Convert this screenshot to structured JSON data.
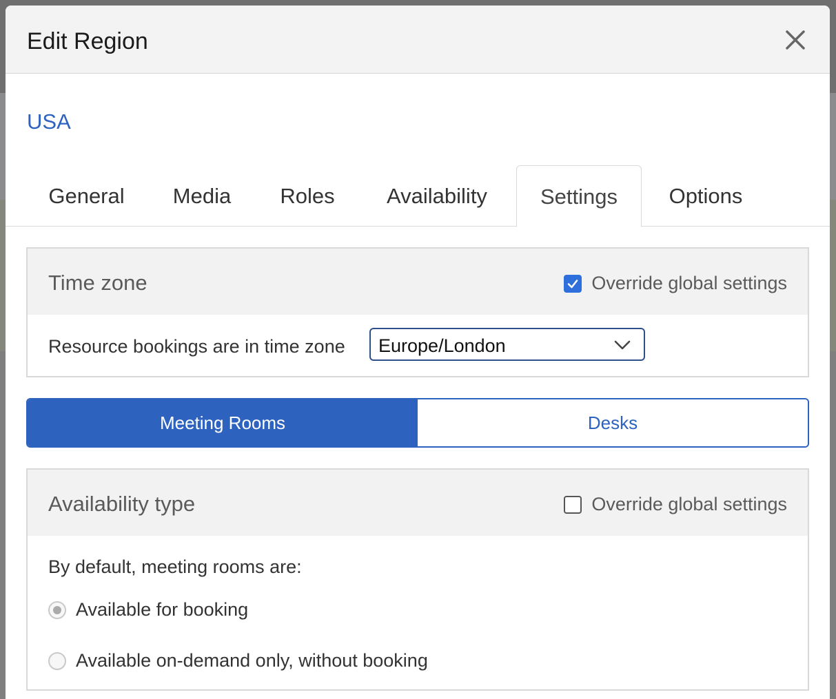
{
  "modal": {
    "title": "Edit Region",
    "close_icon": "close-icon"
  },
  "region": {
    "name": "USA"
  },
  "tabs": [
    {
      "label": "General",
      "active": false
    },
    {
      "label": "Media",
      "active": false
    },
    {
      "label": "Roles",
      "active": false
    },
    {
      "label": "Availability",
      "active": false
    },
    {
      "label": "Settings",
      "active": true
    },
    {
      "label": "Options",
      "active": false
    }
  ],
  "time_zone": {
    "title": "Time zone",
    "override_label": "Override global settings",
    "override_checked": true,
    "row_label": "Resource bookings are in time zone",
    "selected_value": "Europe/London"
  },
  "resource_toggle": {
    "options": [
      {
        "label": "Meeting Rooms",
        "active": true
      },
      {
        "label": "Desks",
        "active": false
      }
    ]
  },
  "availability_type": {
    "title": "Availability type",
    "override_label": "Override global settings",
    "override_checked": false,
    "intro": "By default, meeting rooms are:",
    "options": [
      {
        "label": "Available for booking",
        "selected": true
      },
      {
        "label": "Available on-demand only, without booking",
        "selected": false
      }
    ]
  },
  "colors": {
    "accent": "#2d62bf",
    "checkbox_checked": "#2f6fdb",
    "header_bg": "#f3f3f3"
  }
}
